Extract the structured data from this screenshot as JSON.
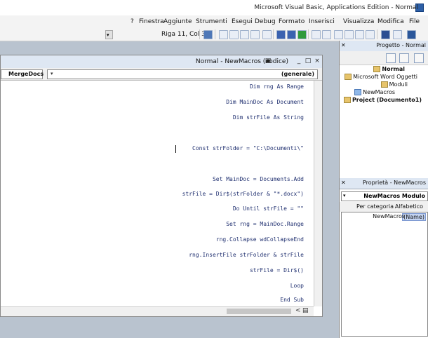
{
  "app": {
    "title": "Microsoft Visual Basic, Applications Edition - Normal"
  },
  "menus": [
    "File",
    "Modifica",
    "Visualizza",
    "Inserisci",
    "Formato",
    "Debug",
    "Esegui",
    "Strumenti",
    "Aggiunte",
    "Finestra",
    "?"
  ],
  "toolbar": {
    "position_label": "Riga 11, Col 34",
    "icons": [
      "word-icon",
      "insert-icon",
      "save-icon",
      "cut-icon",
      "copy-icon",
      "paste-icon",
      "find-icon",
      "undo-icon",
      "redo-icon",
      "run-icon",
      "break-icon",
      "reset-icon",
      "design-icon",
      "project-icon",
      "properties-icon",
      "object-browser-icon",
      "toolbox-icon",
      "help-icon"
    ]
  },
  "code_window": {
    "title": "Normal - NewMacros (codice)",
    "object_combo": "(generale)",
    "proc_combo": "MergeDocs",
    "lines": [
      "Dim rng As Range",
      "Dim MainDoc As Document",
      "Dim strFile As String",
      "Const strFolder = \"C:\\Documenti\\\"",
      "Set MainDoc = Documents.Add",
      "strFile = Dir$(strFolder & \"*.docx\")",
      "Do Until strFile = \"\"",
      "Set rng = MainDoc.Range",
      "rng.Collapse wdCollapseEnd",
      "rng.InsertFile strFolder & strFile",
      "strFile = Dir$()",
      "Loop",
      "End Sub"
    ]
  },
  "project_explorer": {
    "title": "Progetto - Normal",
    "tree": [
      {
        "label": "Normal"
      },
      {
        "label": "Microsoft Word Oggetti"
      },
      {
        "label": "Moduli"
      },
      {
        "label": "NewMacros"
      },
      {
        "label": "Project (Documento1)"
      }
    ]
  },
  "properties": {
    "title": "Proprietà - NewMacros",
    "object_combo": "NewMacros Modulo",
    "tabs": [
      "Alfabetico",
      "Per categoria"
    ],
    "rows": [
      {
        "name": "(Name)",
        "value": "NewMacros"
      }
    ]
  }
}
